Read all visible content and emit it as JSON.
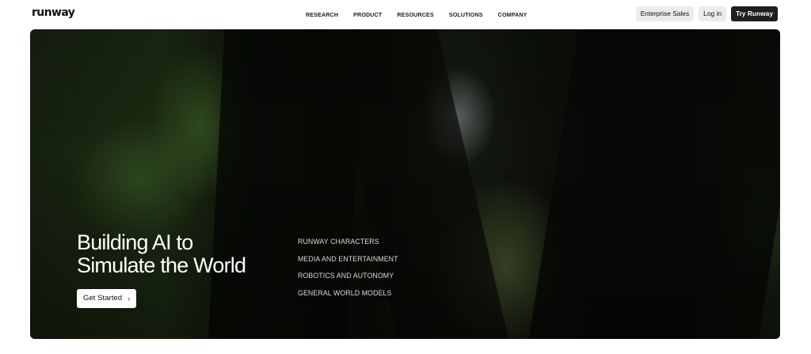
{
  "header": {
    "logo": "runway",
    "nav": [
      "RESEARCH",
      "PRODUCT",
      "RESOURCES",
      "SOLUTIONS",
      "COMPANY"
    ],
    "enterprise_label": "Enterprise Sales",
    "login_label": "Log in",
    "try_label": "Try Runway"
  },
  "hero": {
    "headline_line1": "Building AI to",
    "headline_line2": "Simulate the World",
    "cta_label": "Get Started",
    "cta_icon": "chevron-right-icon",
    "links": [
      "RUNWAY CHARACTERS",
      "MEDIA AND ENTERTAINMENT",
      "ROBOTICS AND AUTONOMY",
      "GENERAL WORLD MODELS"
    ]
  },
  "colors": {
    "accent_dark": "#1f1f1f",
    "light_button": "#ececec"
  }
}
